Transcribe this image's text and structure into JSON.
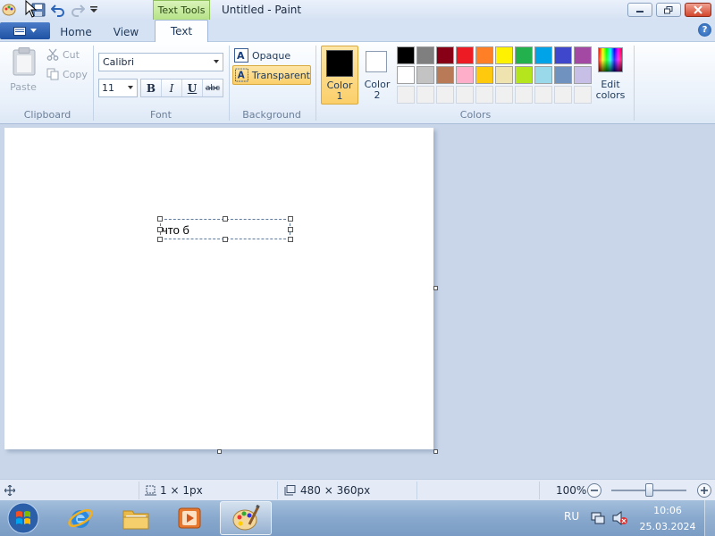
{
  "title": {
    "app_title": "Untitled - Paint",
    "context_tab": "Text Tools"
  },
  "tabs": [
    {
      "label": "Home"
    },
    {
      "label": "View"
    },
    {
      "label": "Text"
    }
  ],
  "clipboard": {
    "paste_label": "Paste",
    "cut_label": "Cut",
    "copy_label": "Copy",
    "group_label": "Clipboard"
  },
  "font": {
    "family": "Calibri",
    "size": "11",
    "group_label": "Font",
    "bold": "B",
    "italic": "I",
    "underline": "U",
    "strike": "abc"
  },
  "background": {
    "opaque_label": "Opaque",
    "transparent_label": "Transparent",
    "group_label": "Background"
  },
  "colors": {
    "color1_label": "Color\n1",
    "color2_label": "Color\n2",
    "color1_value": "#000000",
    "color2_value": "#ffffff",
    "edit_label": "Edit\ncolors",
    "group_label": "Colors",
    "row1": [
      "#000000",
      "#7f7f7f",
      "#880015",
      "#ed1c24",
      "#ff7f27",
      "#fff200",
      "#22b14c",
      "#00a2e8",
      "#3f48cc",
      "#a349a4"
    ],
    "row2": [
      "#ffffff",
      "#c3c3c3",
      "#b97a57",
      "#ffaec9",
      "#ffc90e",
      "#efe4b0",
      "#b5e61d",
      "#99d9ea",
      "#7092be",
      "#c8bfe7"
    ],
    "row3": [
      "#f0f0f0",
      "#f0f0f0",
      "#f0f0f0",
      "#f0f0f0",
      "#f0f0f0",
      "#f0f0f0",
      "#f0f0f0",
      "#f0f0f0",
      "#f0f0f0",
      "#f0f0f0"
    ]
  },
  "canvas": {
    "text_content": "что б"
  },
  "status": {
    "selection_size": "1 × 1px",
    "image_size": "480 × 360px",
    "zoom": "100%"
  },
  "tray": {
    "language": "RU",
    "time": "10:06",
    "date": "25.03.2024"
  }
}
